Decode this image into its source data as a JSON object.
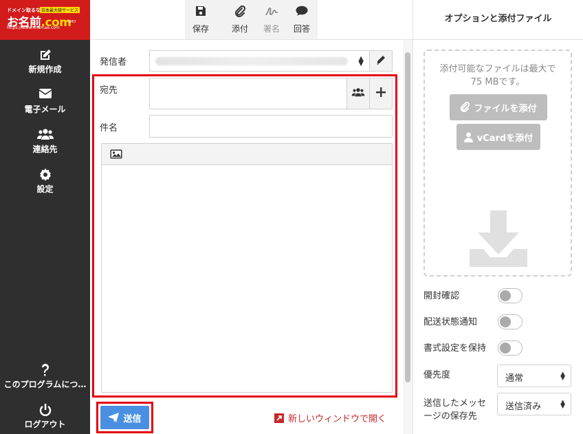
{
  "logo": {
    "line1": "ドメイン取るなら",
    "badge": "日本最大級サービス",
    "brand": "お名前",
    "brand_tld": ".com",
    "url": "https://www.onamae.com",
    "company": "GMO"
  },
  "sidebar": {
    "items": [
      {
        "label": "新規作成",
        "icon": "edit-icon"
      },
      {
        "label": "電子メール",
        "icon": "envelope-icon"
      },
      {
        "label": "連絡先",
        "icon": "users-icon"
      },
      {
        "label": "設定",
        "icon": "gear-icon"
      }
    ],
    "about_label": "このプログラムにつ…",
    "logout_label": "ログアウト"
  },
  "toolbar": {
    "save_label": "保存",
    "attach_label": "添付",
    "signature_label": "署名",
    "respond_label": "回答"
  },
  "form": {
    "from_label": "発信者",
    "to_label": "宛先",
    "subject_label": "件名",
    "to_value": "",
    "subject_value": ""
  },
  "footer": {
    "send_label": "送信",
    "new_window_label": "新しいウィンドウで開く"
  },
  "options": {
    "title": "オプションと添付ファイル",
    "dropzone_text_1": "添付可能なファイルは最大で",
    "dropzone_text_2": "75 MBです。",
    "attach_file_label": "ファイルを添付",
    "attach_vcard_label": "vCardを添付",
    "read_receipt_label": "開封確認",
    "delivery_status_label": "配送状態通知",
    "keep_format_label": "書式設定を保持",
    "priority_label": "優先度",
    "priority_value": "通常",
    "save_sent_label_1": "送信したメッセ",
    "save_sent_label_2": "ージの保存先",
    "save_sent_value": "送信済み"
  },
  "colors": {
    "sidebar_bg": "#2f2f2f",
    "logo_bg": "#d21b1b",
    "send_button": "#4a90e2",
    "highlight_frame": "#e3000f",
    "link_red": "#c62828"
  }
}
